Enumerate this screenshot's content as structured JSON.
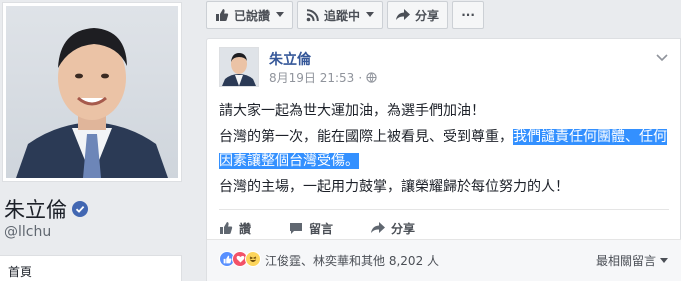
{
  "page": {
    "name": "朱立倫",
    "handle": "@llchu",
    "nav": {
      "home": "首頁"
    }
  },
  "action_bar": {
    "liked_label": "已說讚",
    "following_label": "追蹤中",
    "share_label": "分享",
    "more_label": "···"
  },
  "post": {
    "author": "朱立倫",
    "timestamp": "8月19日 21:53",
    "meta_dot": "·",
    "paragraphs": {
      "p1": "請大家一起為世大運加油，為選手們加油！",
      "p2_plain": "台灣的第一次，能在國際上被看見、受到尊重，",
      "p2_selected": "我們譴責任何團體、任何因素讓整個台灣受傷。",
      "p3": "台灣的主場，一起用力鼓掌，讓榮耀歸於每位努力的人！"
    },
    "actions": {
      "like": "讚",
      "comment": "留言",
      "share": "分享"
    },
    "reactions": {
      "names": "江俊霆、林奕華和其他",
      "count": "8,202 人"
    },
    "sort_label": "最相關留言"
  },
  "colors": {
    "brand_blue": "#4267b2",
    "link_blue": "#365899",
    "selection": "#3390ff"
  },
  "icons": {
    "liked": "thumbs-up-icon",
    "following": "rss-icon",
    "share": "share-arrow-icon",
    "verified": "check-badge-icon",
    "globe": "globe-icon",
    "chevron": "chevron-down-icon"
  }
}
